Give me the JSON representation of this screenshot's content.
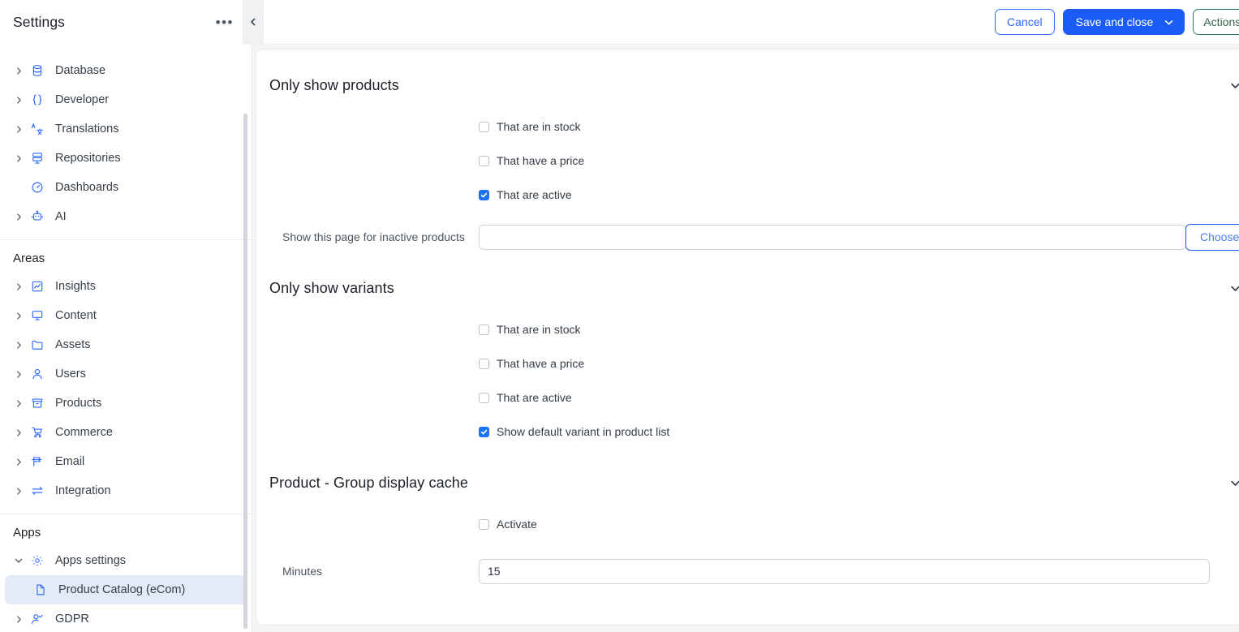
{
  "sidebar": {
    "title": "Settings",
    "overflow_menu": "•••",
    "partial_top_item": "",
    "top_items": [
      {
        "label": "Database",
        "icon": "database-icon",
        "expandable": true
      },
      {
        "label": "Developer",
        "icon": "code-braces-icon",
        "expandable": true
      },
      {
        "label": "Translations",
        "icon": "translate-icon",
        "expandable": true
      },
      {
        "label": "Repositories",
        "icon": "repository-icon",
        "expandable": true
      },
      {
        "label": "Dashboards",
        "icon": "dashboard-icon",
        "expandable": false
      },
      {
        "label": "AI",
        "icon": "robot-icon",
        "expandable": true
      }
    ],
    "areas_group": {
      "title": "Areas",
      "items": [
        {
          "label": "Insights",
          "icon": "chart-line-icon",
          "expandable": true
        },
        {
          "label": "Content",
          "icon": "monitor-icon",
          "expandable": true
        },
        {
          "label": "Assets",
          "icon": "folder-icon",
          "expandable": true
        },
        {
          "label": "Users",
          "icon": "user-icon",
          "expandable": true
        },
        {
          "label": "Products",
          "icon": "box-icon",
          "expandable": true
        },
        {
          "label": "Commerce",
          "icon": "shopping-cart-icon",
          "expandable": true
        },
        {
          "label": "Email",
          "icon": "email-flag-icon",
          "expandable": true
        },
        {
          "label": "Integration",
          "icon": "exchange-arrows-icon",
          "expandable": true
        }
      ]
    },
    "apps_group": {
      "title": "Apps",
      "items": [
        {
          "label": "Apps settings",
          "icon": "gear-icon",
          "expandable": true,
          "expanded": true
        },
        {
          "label": "Product Catalog (eCom)",
          "icon": "file-icon",
          "expandable": false,
          "selected": true,
          "child": true
        },
        {
          "label": "GDPR",
          "icon": "user-check-icon",
          "expandable": true
        }
      ]
    }
  },
  "toolbar": {
    "cancel_label": "Cancel",
    "save_label": "Save and close",
    "actions_label": "Actions"
  },
  "sections": [
    {
      "title": "Only show products",
      "checkboxes": [
        {
          "label": "That are in stock",
          "checked": false
        },
        {
          "label": "That have a price",
          "checked": false
        },
        {
          "label": "That are active",
          "checked": true
        }
      ],
      "field": {
        "label": "Show this page for inactive products",
        "value": "",
        "placeholder": "",
        "button_label": "Choose"
      }
    },
    {
      "title": "Only show variants",
      "checkboxes": [
        {
          "label": "That are in stock",
          "checked": false
        },
        {
          "label": "That have a price",
          "checked": false
        },
        {
          "label": "That are active",
          "checked": false
        },
        {
          "label": "Show default variant in product list",
          "checked": true
        }
      ]
    },
    {
      "title": "Product - Group display cache",
      "checkboxes": [
        {
          "label": "Activate",
          "checked": false
        }
      ],
      "field": {
        "label": "Minutes",
        "value": "15",
        "placeholder": ""
      }
    }
  ],
  "colors": {
    "accent_blue": "#1a5cf5",
    "checkbox_blue": "#1a73f5",
    "actions_green": "#2e7d53",
    "selected_item_bg": "#e4eaf7",
    "page_bg": "#f4f5f7"
  }
}
